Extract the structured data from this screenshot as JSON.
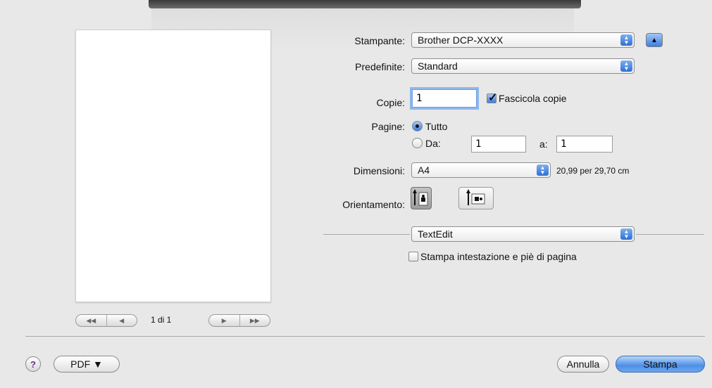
{
  "preview": {
    "page_indicator": "1 di 1",
    "nav_first": "◀◀",
    "nav_prev": "◀",
    "nav_next": "▶",
    "nav_last": "▶▶"
  },
  "printer": {
    "label": "Stampante:",
    "value": "Brother DCP-XXXX",
    "collapse_icon": "triangle-up-icon"
  },
  "presets": {
    "label": "Predefinite:",
    "value": "Standard"
  },
  "copies": {
    "label": "Copie:",
    "value": "1",
    "collate_label": "Fascicola copie",
    "collate_checked": true
  },
  "pages": {
    "label": "Pagine:",
    "all_label": "Tutto",
    "from_label": "Da:",
    "from_value": "1",
    "to_label": "a:",
    "to_value": "1"
  },
  "paper_size": {
    "label": "Dimensioni:",
    "value": "A4",
    "dimensions": "20,99 per 29,70 cm"
  },
  "orientation": {
    "label": "Orientamento:",
    "portrait_icon": "portrait-orientation-icon",
    "landscape_icon": "landscape-orientation-icon"
  },
  "app_options": {
    "value": "TextEdit",
    "header_footer_label": "Stampa intestazione e piè di pagina"
  },
  "footer": {
    "help_label": "?",
    "pdf_label": "PDF ▼",
    "cancel_label": "Annulla",
    "print_label": "Stampa"
  },
  "colors": {
    "accent": "#3f7fe0",
    "background": "#e8e8e8"
  }
}
